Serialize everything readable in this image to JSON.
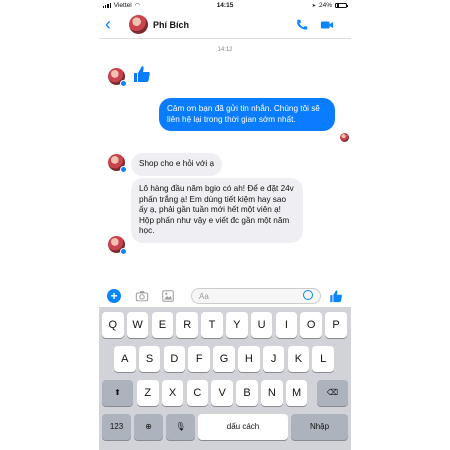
{
  "status": {
    "carrier": "Viettel",
    "time": "14:15",
    "battery": "24%"
  },
  "header": {
    "back_icon": "‹",
    "contact_name": "Phí Bích"
  },
  "chat": {
    "timestamp": "14:12",
    "outgoing": "Cảm ơn bạn đã gửi tin nhắn. Chúng tôi sẽ liên hệ lại trong thời gian sớm nhất.",
    "incoming_1": "Shop cho e hỏi với ạ",
    "incoming_2": "Lô hàng đầu năm bgio có ah! Để e đặt 24v phấn trắng ạ! Em dùng tiết kiệm hay sao ấy ạ, phải gần tuần mới hết một viên ạ! Hộp phấn như vậy e viết đc gần một năm học."
  },
  "composer": {
    "placeholder": "Aa",
    "plus_label": "+"
  },
  "keyboard": {
    "row1": [
      "Q",
      "W",
      "E",
      "R",
      "T",
      "Y",
      "U",
      "I",
      "O",
      "P"
    ],
    "row2": [
      "A",
      "S",
      "D",
      "F",
      "G",
      "H",
      "J",
      "K",
      "L"
    ],
    "row3": [
      "Z",
      "X",
      "C",
      "V",
      "B",
      "N",
      "M"
    ],
    "num_label": "123",
    "space_label": "dấu cách",
    "return_label": "Nhập"
  }
}
